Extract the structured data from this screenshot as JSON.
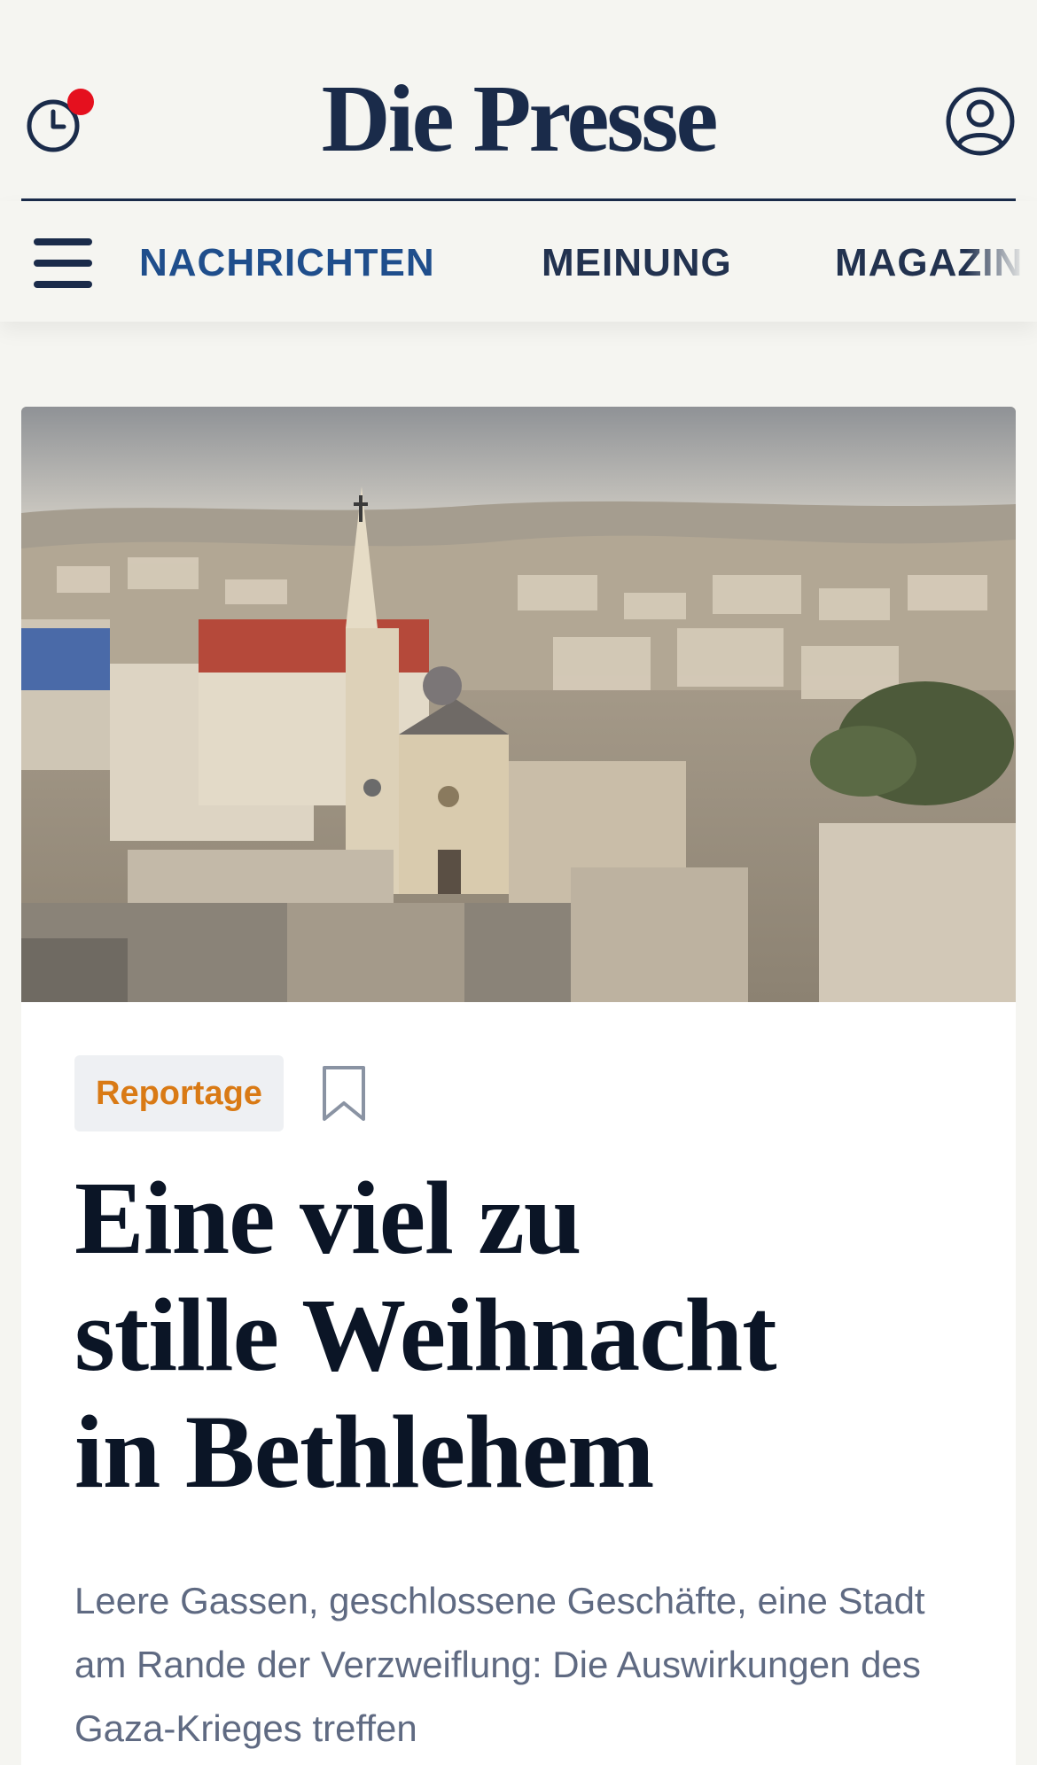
{
  "header": {
    "logo": "Die Presse",
    "history_icon": "clock-icon",
    "account_icon": "user-circle-icon",
    "notification_color": "#e5101e"
  },
  "nav": {
    "menu_icon": "hamburger-menu-icon",
    "items": [
      {
        "label": "NACHRICHTEN",
        "active": true
      },
      {
        "label": "MEINUNG",
        "active": false
      },
      {
        "label": "MAGAZIN",
        "active": false
      }
    ]
  },
  "article": {
    "image_alt": "Aerial view of Bethlehem with church tower",
    "tag": "Reportage",
    "bookmark_icon": "bookmark-icon",
    "headline_lines": [
      "Eine viel zu",
      "stille Weihnacht",
      "in Bethlehem"
    ],
    "lead": "Leere Gassen, geschlossene Geschäfte, eine Stadt am Rande der Verzweiflung: Die Auswirkungen des Gaza-Krieges treffen"
  },
  "colors": {
    "brand_navy": "#1a2b4a",
    "nav_active": "#1f4e8c",
    "tag_text": "#d97a15",
    "lead_text": "#5f6a82"
  }
}
